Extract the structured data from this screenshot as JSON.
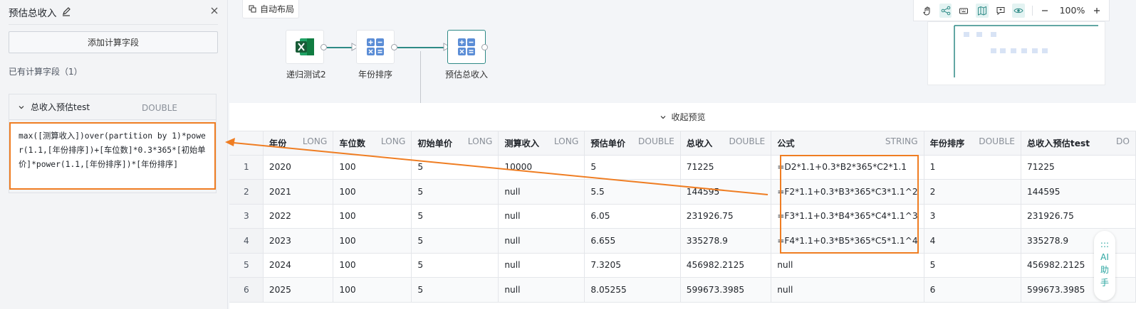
{
  "panel": {
    "title": "预估总收入",
    "add_button": "添加计算字段",
    "existing_label": "已有计算字段（1）",
    "field": {
      "name": "总收入预估test",
      "type": "DOUBLE",
      "formula": "max([测算收入])over(partition by 1)*power(1.1,[年份排序])+[车位数]*0.3*365*[初始单价]*power(1.1,[年份排序])*[年份排序]"
    }
  },
  "canvas": {
    "auto_layout": "自动布局",
    "nodes": [
      {
        "label": "递归测试2",
        "icon": "excel-icon"
      },
      {
        "label": "年份排序",
        "icon": "calculator-icon"
      },
      {
        "label": "预估总收入",
        "icon": "calculator-icon"
      }
    ],
    "zoom": "100%"
  },
  "preview": {
    "collapse_label": "收起预览",
    "columns": [
      {
        "name": "",
        "type": ""
      },
      {
        "name": "年份",
        "type": "LONG"
      },
      {
        "name": "车位数",
        "type": "LONG"
      },
      {
        "name": "初始单价",
        "type": "LONG"
      },
      {
        "name": "测算收入",
        "type": "LONG"
      },
      {
        "name": "预估单价",
        "type": "DOUBLE"
      },
      {
        "name": "总收入",
        "type": "DOUBLE"
      },
      {
        "name": "公式",
        "type": "STRING"
      },
      {
        "name": "年份排序",
        "type": "DOUBLE"
      },
      {
        "name": "总收入预估test",
        "type": "DO"
      }
    ],
    "rows": [
      [
        "1",
        "2020",
        "100",
        "5",
        "10000",
        "5",
        "71225",
        "=D2*1.1+0.3*B2*365*C2*1.1",
        "1",
        "71225"
      ],
      [
        "2",
        "2021",
        "100",
        "5",
        "null",
        "5.5",
        "144595",
        "=F2*1.1+0.3*B3*365*C3*1.1^2",
        "2",
        "144595"
      ],
      [
        "3",
        "2022",
        "100",
        "5",
        "null",
        "6.05",
        "231926.75",
        "=F3*1.1+0.3*B4*365*C4*1.1^3",
        "3",
        "231926.75"
      ],
      [
        "4",
        "2023",
        "100",
        "5",
        "null",
        "6.655",
        "335278.9",
        "=F4*1.1+0.3*B5*365*C5*1.1^4",
        "4",
        "335278.9"
      ],
      [
        "5",
        "2024",
        "100",
        "5",
        "null",
        "7.3205",
        "456982.2125",
        "null",
        "5",
        "456982.2125"
      ],
      [
        "6",
        "2025",
        "100",
        "5",
        "null",
        "8.05255",
        "599673.3985",
        "null",
        "6",
        "599673.3985"
      ]
    ]
  },
  "ai_assistant": {
    "chars": [
      ":::",
      "AI",
      "助",
      "手"
    ]
  },
  "colors": {
    "accent": "#2e8a86",
    "highlight": "#ef7d22"
  }
}
